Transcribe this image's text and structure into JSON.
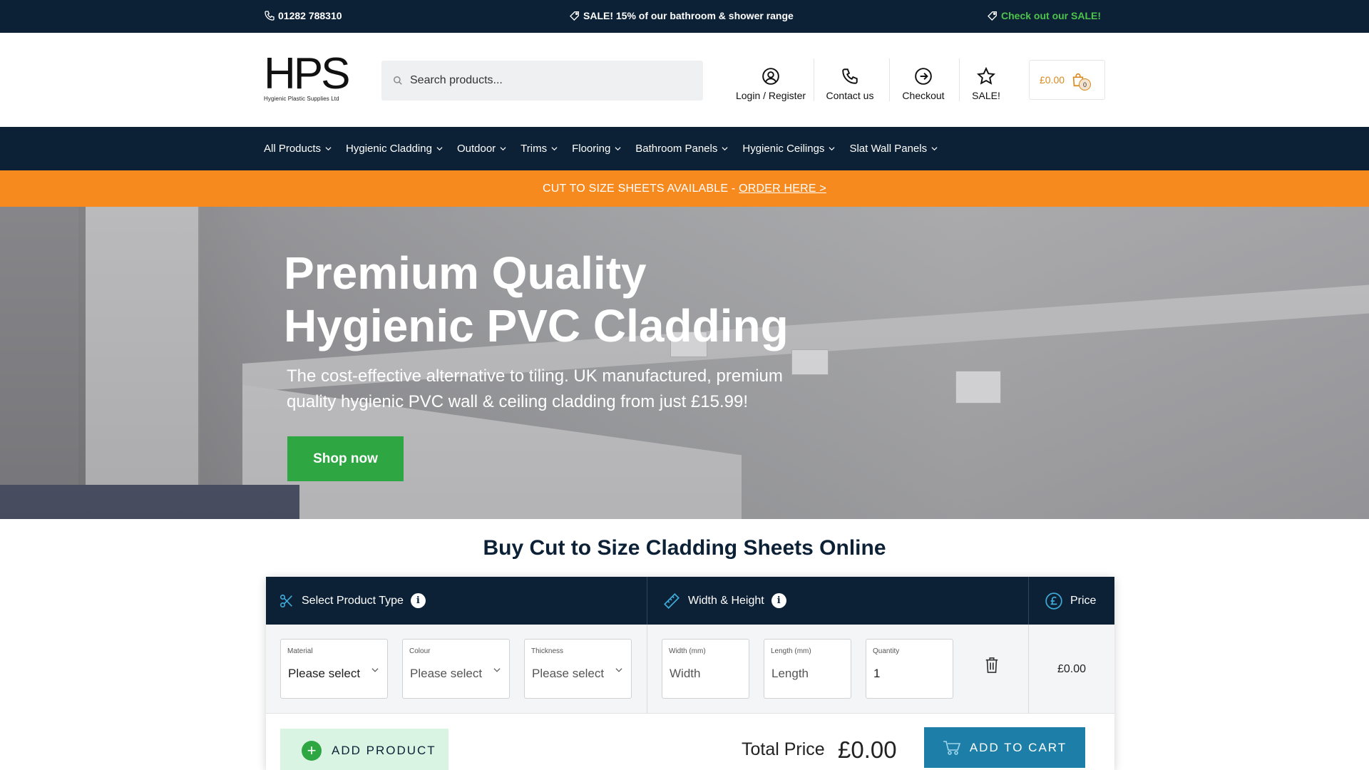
{
  "topbar": {
    "phone": "01282 788310",
    "sale_message": "SALE! 15% of our bathroom & shower range",
    "sale_link": "Check out our SALE!"
  },
  "header": {
    "logo_text": "HPS",
    "logo_subtext": "Hygienic Plastic Supplies Ltd",
    "search_placeholder": "Search products...",
    "links": {
      "login": "Login / Register",
      "contact": "Contact us",
      "checkout": "Checkout",
      "sale": "SALE!"
    },
    "cart_total": "£0.00",
    "cart_count": "0"
  },
  "nav": {
    "items": [
      "All Products",
      "Hygienic Cladding",
      "Outdoor",
      "Trims",
      "Flooring",
      "Bathroom Panels",
      "Hygienic Ceilings",
      "Slat Wall Panels"
    ]
  },
  "banner": {
    "text": "CUT TO SIZE SHEETS AVAILABLE - ",
    "link": "ORDER HERE >"
  },
  "hero": {
    "title_line1": "Premium Quality",
    "title_line2": "Hygienic PVC Cladding",
    "subtitle": "The cost-effective alternative to tiling. UK manufactured, premium quality hygienic PVC wall & ceiling cladding from just £15.99!",
    "button": "Shop now"
  },
  "calculator": {
    "section_title": "Buy Cut to Size Cladding Sheets Online",
    "headers": {
      "product_type": "Select Product Type",
      "dimensions": "Width & Height",
      "price": "Price"
    },
    "fields": {
      "material": {
        "label": "Material",
        "value": "Please select"
      },
      "colour": {
        "label": "Colour",
        "value": "Please select"
      },
      "thickness": {
        "label": "Thickness",
        "value": "Please select"
      },
      "width": {
        "label": "Width (mm)",
        "placeholder": "Width"
      },
      "length": {
        "label": "Length (mm)",
        "placeholder": "Length"
      },
      "quantity": {
        "label": "Quantity",
        "value": "1"
      }
    },
    "row_price": "£0.00",
    "add_product": "ADD PRODUCT",
    "total_label": "Total Price",
    "total_value": "£0.00",
    "add_to_cart": "ADD TO CART"
  },
  "colors": {
    "navy": "#0c2136",
    "orange": "#f78a1f",
    "green": "#2ea642",
    "teal": "#1d7fa8"
  }
}
